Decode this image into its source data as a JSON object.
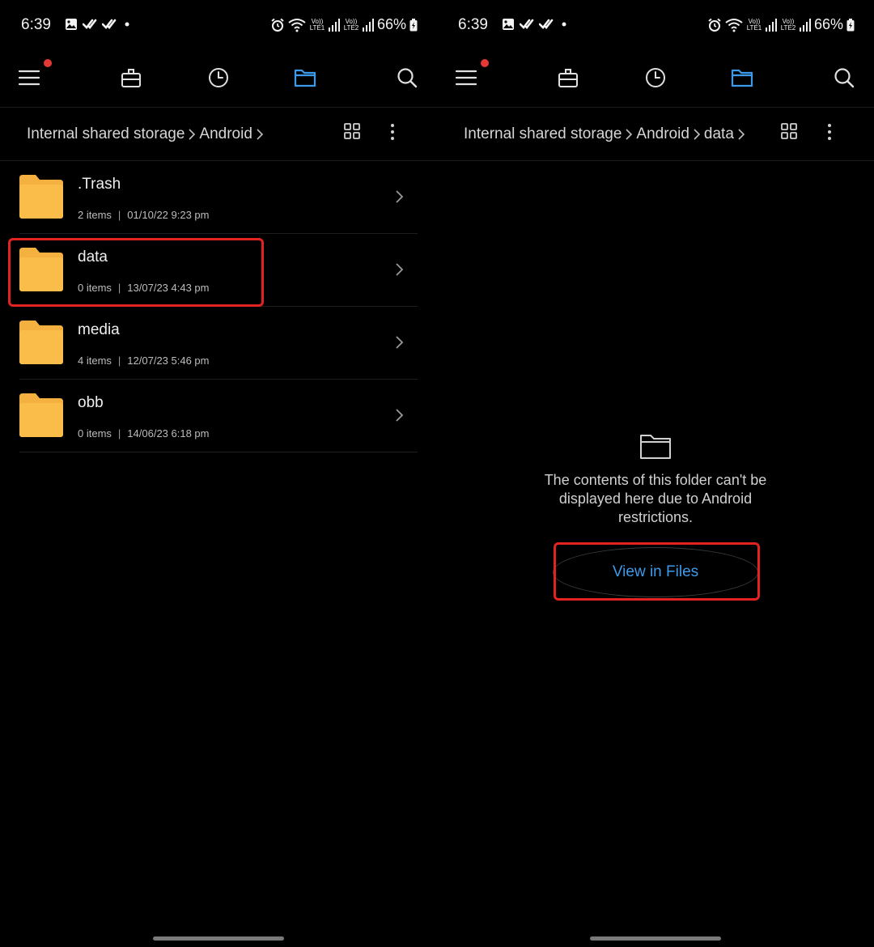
{
  "panels": [
    {
      "status": {
        "time": "6:39",
        "volte1": "Vo)) LTE1",
        "volte2": "Vo)) LTE2",
        "battery": "66%"
      },
      "breadcrumb": [
        "Internal shared storage",
        "Android"
      ],
      "files": [
        {
          "name": ".Trash",
          "items": "2 items",
          "date": "01/10/22 9:23 pm"
        },
        {
          "name": "data",
          "items": "0 items",
          "date": "13/07/23 4:43 pm"
        },
        {
          "name": "media",
          "items": "4 items",
          "date": "12/07/23 5:46 pm"
        },
        {
          "name": "obb",
          "items": "0 items",
          "date": "14/06/23 6:18 pm"
        }
      ]
    },
    {
      "status": {
        "time": "6:39",
        "volte1": "Vo)) LTE1",
        "volte2": "Vo)) LTE2",
        "battery": "66%"
      },
      "breadcrumb": [
        "Internal shared storage",
        "Android",
        "data"
      ],
      "empty_message": "The contents of this folder can't be displayed here due to Android restrictions.",
      "view_button": "View in Files"
    }
  ],
  "icons": {
    "menu": "hamburger-icon",
    "tools": "toolbox-icon",
    "recent": "clock-icon",
    "files": "folder-icon",
    "search": "search-icon",
    "grid": "grid-view-icon",
    "more": "more-vert-icon"
  },
  "colors": {
    "background": "#000000",
    "accent": "#3d9ae8",
    "folder": "#fbbd4a",
    "notification_dot": "#e53935",
    "highlight": "#e32222"
  }
}
